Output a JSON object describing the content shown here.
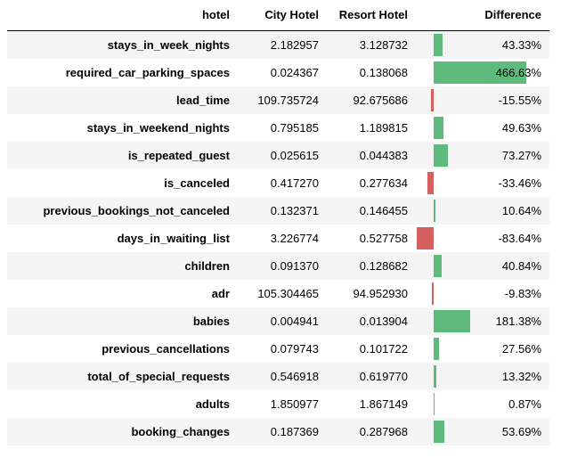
{
  "header": {
    "index_label": "hotel",
    "col_city": "City Hotel",
    "col_resort": "Resort Hotel",
    "col_diff": "Difference"
  },
  "colors": {
    "positive": "#5fba7d",
    "negative": "#d65f5f",
    "stripe": "#f5f5f5"
  },
  "rows": [
    {
      "name": "stays_in_week_nights",
      "city": "2.182957",
      "resort": "3.128732",
      "diff": "43.33%",
      "diff_value": 43.33
    },
    {
      "name": "required_car_parking_spaces",
      "city": "0.024367",
      "resort": "0.138068",
      "diff": "466.63%",
      "diff_value": 466.63
    },
    {
      "name": "lead_time",
      "city": "109.735724",
      "resort": "92.675686",
      "diff": "-15.55%",
      "diff_value": -15.55
    },
    {
      "name": "stays_in_weekend_nights",
      "city": "0.795185",
      "resort": "1.189815",
      "diff": "49.63%",
      "diff_value": 49.63
    },
    {
      "name": "is_repeated_guest",
      "city": "0.025615",
      "resort": "0.044383",
      "diff": "73.27%",
      "diff_value": 73.27
    },
    {
      "name": "is_canceled",
      "city": "0.417270",
      "resort": "0.277634",
      "diff": "-33.46%",
      "diff_value": -33.46
    },
    {
      "name": "previous_bookings_not_canceled",
      "city": "0.132371",
      "resort": "0.146455",
      "diff": "10.64%",
      "diff_value": 10.64
    },
    {
      "name": "days_in_waiting_list",
      "city": "3.226774",
      "resort": "0.527758",
      "diff": "-83.64%",
      "diff_value": -83.64
    },
    {
      "name": "children",
      "city": "0.091370",
      "resort": "0.128682",
      "diff": "40.84%",
      "diff_value": 40.84
    },
    {
      "name": "adr",
      "city": "105.304465",
      "resort": "94.952930",
      "diff": "-9.83%",
      "diff_value": -9.83
    },
    {
      "name": "babies",
      "city": "0.004941",
      "resort": "0.013904",
      "diff": "181.38%",
      "diff_value": 181.38
    },
    {
      "name": "previous_cancellations",
      "city": "0.079743",
      "resort": "0.101722",
      "diff": "27.56%",
      "diff_value": 27.56
    },
    {
      "name": "total_of_special_requests",
      "city": "0.546918",
      "resort": "0.619770",
      "diff": "13.32%",
      "diff_value": 13.32
    },
    {
      "name": "adults",
      "city": "1.850977",
      "resort": "1.867149",
      "diff": "0.87%",
      "diff_value": 0.87
    },
    {
      "name": "booking_changes",
      "city": "0.187369",
      "resort": "0.287968",
      "diff": "53.69%",
      "diff_value": 53.69
    }
  ]
}
